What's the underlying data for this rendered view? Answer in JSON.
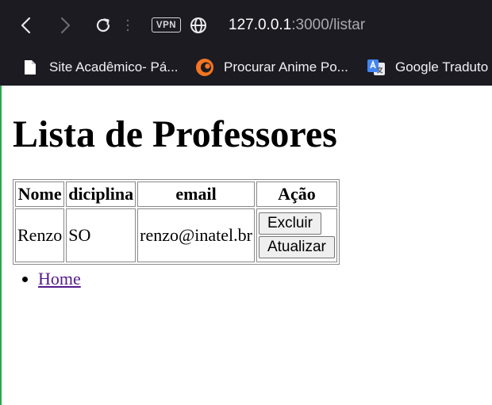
{
  "browser": {
    "url_host": "127.0.0.1",
    "url_path": ":3000/listar",
    "vpn_label": "VPN",
    "bookmarks": [
      {
        "label": "Site Acadêmico- Pá...",
        "icon": "file-icon"
      },
      {
        "label": "Procurar Anime Po...",
        "icon": "crunchyroll-icon"
      },
      {
        "label": "Google Traduto",
        "icon": "google-translate-icon"
      }
    ]
  },
  "page": {
    "title": "Lista de Professores",
    "table": {
      "headers": [
        "Nome",
        "diciplina",
        "email",
        "Ação"
      ],
      "rows": [
        {
          "nome": "Renzo",
          "disciplina": "SO",
          "email": "renzo@inatel.br",
          "delete_label": "Excluir",
          "update_label": "Atualizar"
        }
      ]
    },
    "links": [
      {
        "label": "Home"
      }
    ]
  }
}
